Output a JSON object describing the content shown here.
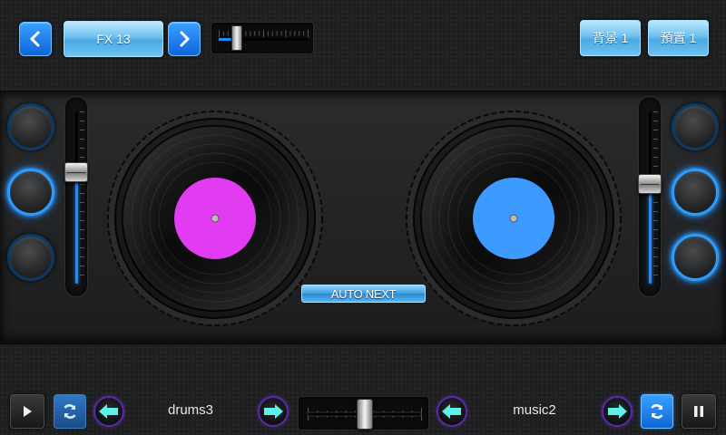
{
  "top_bar": {
    "prev_icon": "chevron-left-icon",
    "effect_label": "FX 13",
    "next_icon": "chevron-right-icon",
    "effect_level": 0.2,
    "background_label": "背景 1",
    "preset_label": "預置 1"
  },
  "left_deck": {
    "label_color": "#e23cf2",
    "pitch_level": 0.35,
    "pads": [
      {
        "active": false
      },
      {
        "active": true
      },
      {
        "active": false
      }
    ]
  },
  "right_deck": {
    "label_color": "#3d9bff",
    "pitch_level": 0.42,
    "pads": [
      {
        "active": false
      },
      {
        "active": true
      },
      {
        "active": true
      }
    ]
  },
  "auto_next_label": "AUTO NEXT",
  "bottom_bar": {
    "play_icon": "play-icon",
    "pause_icon": "pause-icon",
    "sync_icon": "sync-icon",
    "left_track": "drums3",
    "right_track": "music2",
    "crossfader_level": 0.5
  },
  "colors": {
    "accent_blue": "#1e8bff",
    "arrow_cyan": "#5ff0e8",
    "ring_purple": "#5a2aa8"
  }
}
